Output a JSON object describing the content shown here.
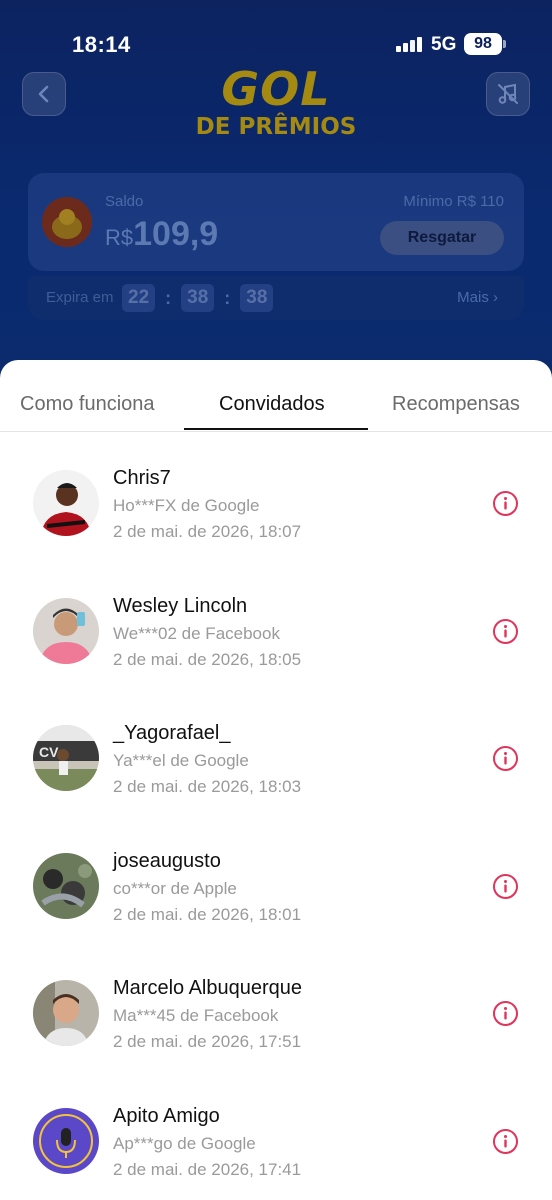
{
  "status_bar": {
    "time": "18:14",
    "network": "5G",
    "battery": "98"
  },
  "header": {
    "logo_line1": "GOL",
    "logo_line2": "DE PRÊMIOS"
  },
  "balance": {
    "label": "Saldo",
    "currency": "R$",
    "value": "109,9",
    "minimum_label": "Mínimo  R$ 110",
    "redeem_label": "Resgatar"
  },
  "expiry": {
    "label": "Expira em",
    "hours": "22",
    "minutes": "38",
    "seconds": "38",
    "more_label": "Mais ›"
  },
  "tabs": [
    {
      "label": "Como funciona",
      "active": false
    },
    {
      "label": "Convidados",
      "active": true
    },
    {
      "label": "Recompensas",
      "active": false
    }
  ],
  "invitees": [
    {
      "name": "Chris7",
      "source": "Ho***FX de Google",
      "date": "2 de mai. de 2026, 18:07",
      "avatar_color": "#7a1a1a"
    },
    {
      "name": "Wesley Lincoln",
      "source": "We***02 de Facebook",
      "date": "2 de mai. de 2026, 18:05",
      "avatar_color": "#e77a9a"
    },
    {
      "name": "_Yagorafael_",
      "source": "Ya***el de Google",
      "date": "2 de mai. de 2026, 18:03",
      "avatar_color": "#8a8a7a"
    },
    {
      "name": "joseaugusto",
      "source": "co***or de Apple",
      "date": "2 de mai. de 2026, 18:01",
      "avatar_color": "#4a5a4a"
    },
    {
      "name": "Marcelo Albuquerque",
      "source": "Ma***45 de Facebook",
      "date": "2 de mai. de 2026, 17:51",
      "avatar_color": "#c9a48a"
    },
    {
      "name": "Apito Amigo",
      "source": "Ap***go de Google",
      "date": "2 de mai. de 2026, 17:41",
      "avatar_color": "#5a48c8"
    }
  ],
  "colors": {
    "info_icon": "#e0345a",
    "accent_gold": "#a58a12"
  }
}
